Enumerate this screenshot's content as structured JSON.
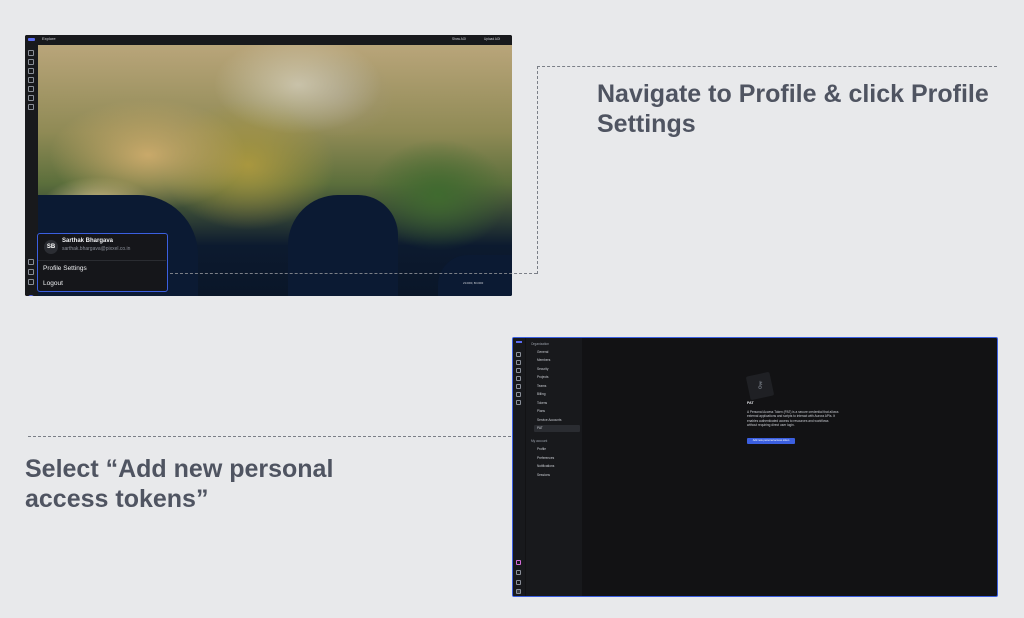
{
  "explore": {
    "title": "Explore",
    "show_aoi_label": "Show AOI",
    "upload_aoi_label": "Upload AOI",
    "coords": "23.0000, 80.0000",
    "profile_popup": {
      "avatar_initials": "SB",
      "name": "Sarthak Bhargava",
      "email": "sarthak.bhargava@pixxel.co.in",
      "profile_settings": "Profile Settings",
      "logout": "Logout"
    },
    "rail_avatar": "SB"
  },
  "captions": {
    "step1": "Navigate to Profile & click Profile Settings",
    "step2": "Select “Add new personal access tokens”"
  },
  "settings": {
    "org_header": "Organization",
    "org_items": [
      "General",
      "Members",
      "Security",
      "Projects",
      "Teams",
      "Billing",
      "Tokens",
      "Plans",
      "Service Accounts",
      "PAT"
    ],
    "account_header": "My account",
    "account_items": [
      "Profile",
      "Preferences",
      "Notifications",
      "Sessions"
    ],
    "pat_title": "PAT",
    "pat_description": "A Personal Access Token (PAT) is a secure credential that allows external applications and scripts to interact with Aurora APIs. It enables authenticated access to resources and workflows without requiring direct user login.",
    "add_button": "Add new personal access token"
  },
  "icons": {
    "key": "key-icon",
    "brand_color": "#3b5fe0"
  }
}
